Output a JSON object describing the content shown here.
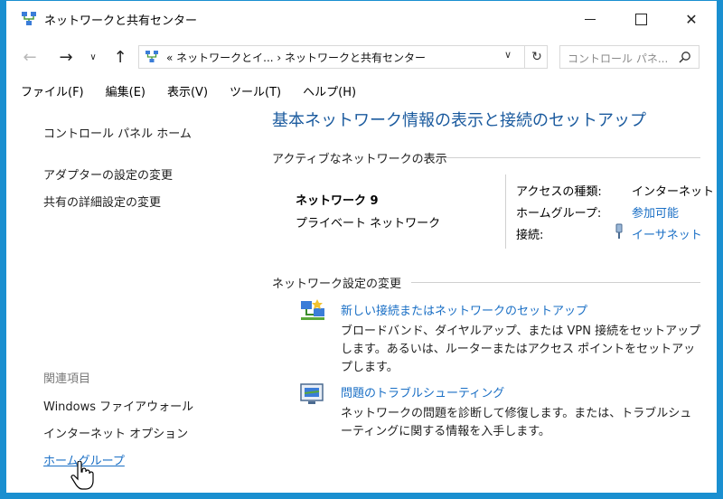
{
  "window": {
    "title": "ネットワークと共有センター"
  },
  "address": {
    "path": "«  ネットワークとイ...  ›  ネットワークと共有センター",
    "search_placeholder": "コントロール パネ..."
  },
  "menu": [
    "ファイル(F)",
    "編集(E)",
    "表示(V)",
    "ツール(T)",
    "ヘルプ(H)"
  ],
  "left_pane": {
    "control_panel_home": "コントロール パネル ホーム",
    "adapter_settings": "アダプターの設定の変更",
    "sharing_settings": "共有の詳細設定の変更",
    "related_heading": "関連項目",
    "related": [
      "Windows ファイアウォール",
      "インターネット オプション",
      "ホームグループ"
    ]
  },
  "main": {
    "title": "基本ネットワーク情報の表示と接続のセットアップ",
    "active_heading": "アクティブなネットワークの表示",
    "network_name": "ネットワーク 9",
    "network_type": "プライベート ネットワーク",
    "access_label": "アクセスの種類:",
    "access_value": "インターネット",
    "homegroup_label": "ホームグループ:",
    "homegroup_value": "参加可能",
    "connection_label": "接続:",
    "connection_value": "イーサネット",
    "change_heading": "ネットワーク設定の変更",
    "task1_link": "新しい接続またはネットワークのセットアップ",
    "task1_desc": "ブロードバンド、ダイヤルアップ、または VPN 接続をセットアップします。あるいは、ルーターまたはアクセス ポイントをセットアップします。",
    "task2_link": "問題のトラブルシューティング",
    "task2_desc": "ネットワークの問題を診断して修復します。または、トラブルシューティングに関する情報を入手します。"
  },
  "colors": {
    "link": "#1a6fc5",
    "title": "#1a5a9e",
    "frame": "#1a8fd0"
  }
}
